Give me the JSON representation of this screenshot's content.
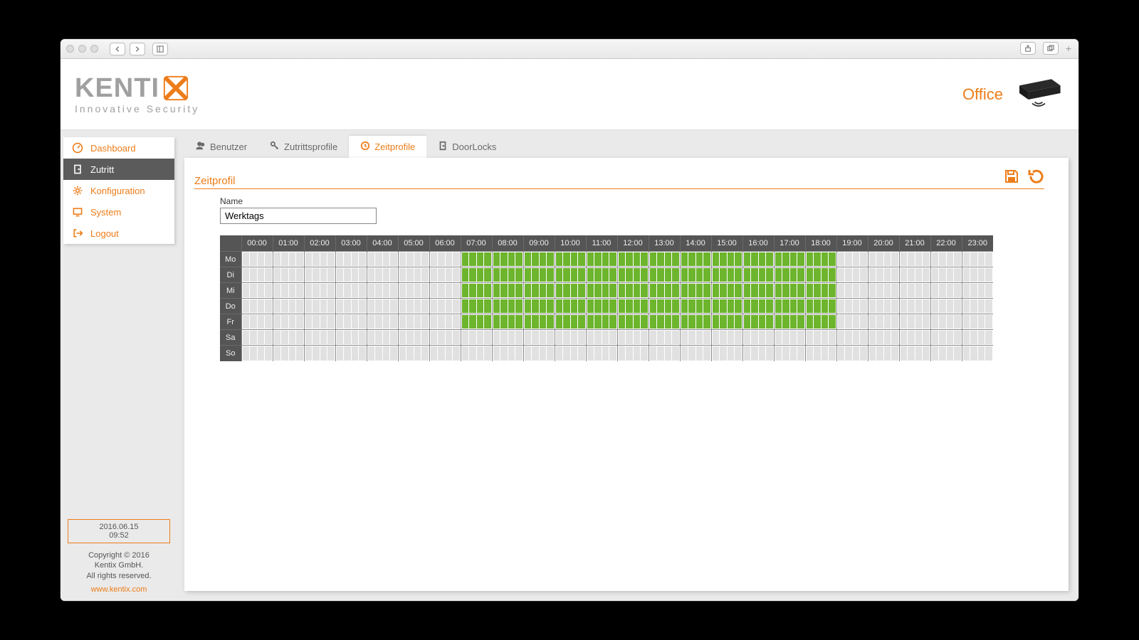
{
  "header": {
    "brand": "KENTI",
    "tagline": "Innovative Security",
    "office": "Office"
  },
  "sidebar": {
    "items": [
      {
        "label": "Dashboard",
        "icon": "gauge",
        "active": false
      },
      {
        "label": "Zutritt",
        "icon": "door",
        "active": true
      },
      {
        "label": "Konfiguration",
        "icon": "gear",
        "active": false
      },
      {
        "label": "System",
        "icon": "monitor",
        "active": false
      },
      {
        "label": "Logout",
        "icon": "logout",
        "active": false
      }
    ],
    "date": "2016.06.15",
    "time": "09:52",
    "copyright1": "Copyright © 2016",
    "copyright2": "Kentix GmbH.",
    "copyright3": "All rights reserved.",
    "link": "www.kentix.com"
  },
  "tabs": [
    {
      "label": "Benutzer",
      "icon": "users",
      "active": false
    },
    {
      "label": "Zutrittsprofile",
      "icon": "key",
      "active": false
    },
    {
      "label": "Zeitprofile",
      "icon": "clock",
      "active": true
    },
    {
      "label": "DoorLocks",
      "icon": "doorlock",
      "active": false
    }
  ],
  "panel": {
    "title": "Zeitprofil",
    "name_label": "Name",
    "name_value": "Werktags"
  },
  "schedule": {
    "hours": [
      "00:00",
      "01:00",
      "02:00",
      "03:00",
      "04:00",
      "05:00",
      "06:00",
      "07:00",
      "08:00",
      "09:00",
      "10:00",
      "11:00",
      "12:00",
      "13:00",
      "14:00",
      "15:00",
      "16:00",
      "17:00",
      "18:00",
      "19:00",
      "20:00",
      "21:00",
      "22:00",
      "23:00"
    ],
    "days": [
      "Mo",
      "Di",
      "Mi",
      "Do",
      "Fr",
      "Sa",
      "So"
    ],
    "active_range": {
      "start": 7,
      "end": 18
    },
    "active_days": [
      0,
      1,
      2,
      3,
      4
    ]
  }
}
